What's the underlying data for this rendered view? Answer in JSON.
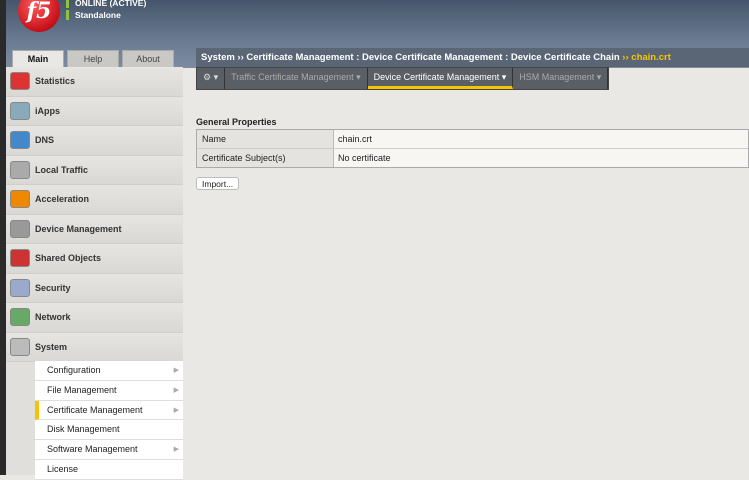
{
  "header": {
    "logo": "f5",
    "status": "ONLINE (ACTIVE)",
    "mode": "Standalone"
  },
  "tabs": [
    "Main",
    "Help",
    "About"
  ],
  "sidebar": [
    "Statistics",
    "iApps",
    "DNS",
    "Local Traffic",
    "Acceleration",
    "Device Management",
    "Shared Objects",
    "Security",
    "Network",
    "System"
  ],
  "submenu": [
    {
      "label": "Configuration",
      "arrow": true
    },
    {
      "label": "File Management",
      "arrow": true
    },
    {
      "label": "Certificate Management",
      "arrow": true,
      "active": true
    },
    {
      "label": "Disk Management",
      "arrow": false
    },
    {
      "label": "Software Management",
      "arrow": true
    },
    {
      "label": "License",
      "arrow": false
    }
  ],
  "breadcrumb": {
    "path": "System  ››  Certificate Management : Device Certificate Management : Device Certificate Chain",
    "sep": "  ››  ",
    "current": "chain.crt"
  },
  "nav": {
    "gear": "⚙ ▾",
    "items": [
      "Traffic Certificate Management ▾",
      "Device Certificate Management ▾",
      "HSM Management ▾"
    ]
  },
  "main": {
    "section": "General Properties",
    "rows": [
      {
        "k": "Name",
        "v": "chain.crt"
      },
      {
        "k": "Certificate Subject(s)",
        "v": "No certificate"
      }
    ],
    "import": "Import..."
  }
}
